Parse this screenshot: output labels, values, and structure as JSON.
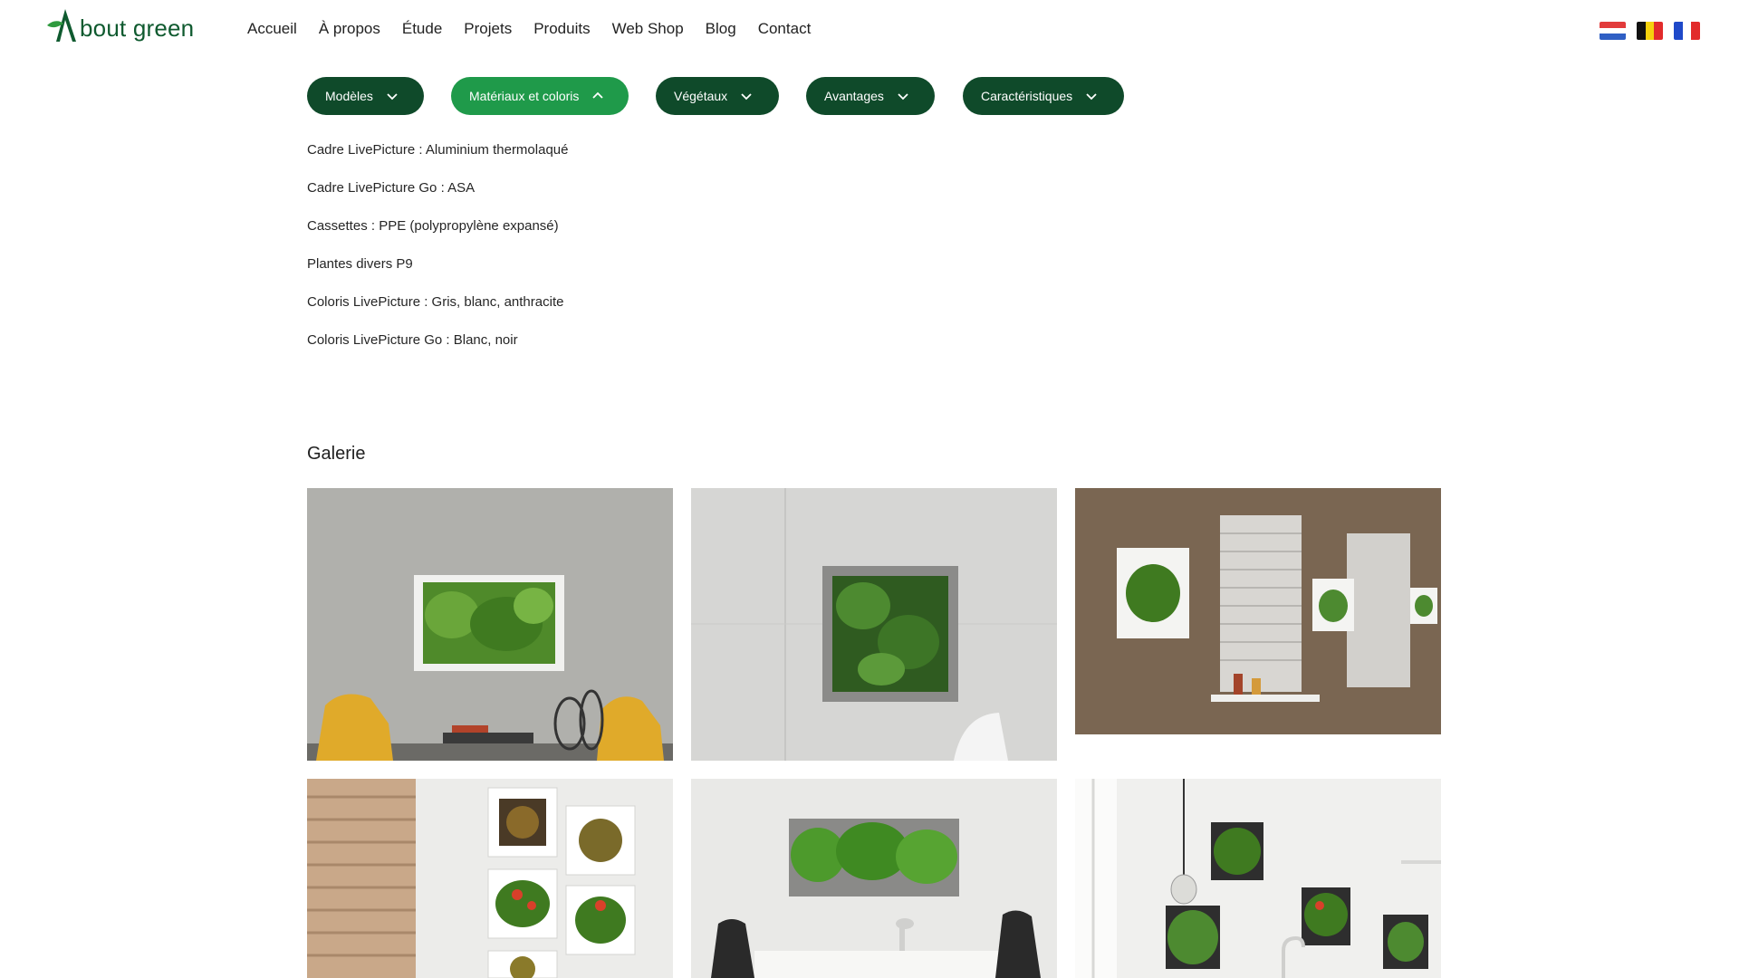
{
  "brand": {
    "name": "bout green"
  },
  "nav": {
    "items": [
      {
        "label": "Accueil"
      },
      {
        "label": "À propos"
      },
      {
        "label": "Étude"
      },
      {
        "label": "Projets"
      },
      {
        "label": "Produits"
      },
      {
        "label": "Web Shop"
      },
      {
        "label": "Blog"
      },
      {
        "label": "Contact"
      }
    ]
  },
  "languages": [
    {
      "name": "Nederlands",
      "icon": "flag-nl-icon"
    },
    {
      "name": "Belgique",
      "icon": "flag-be-icon"
    },
    {
      "name": "Français",
      "icon": "flag-fr-icon"
    }
  ],
  "filters": [
    {
      "label": "Modèles",
      "state": "collapsed"
    },
    {
      "label": "Matériaux et coloris",
      "state": "expanded"
    },
    {
      "label": "Végétaux",
      "state": "collapsed"
    },
    {
      "label": "Avantages",
      "state": "collapsed"
    },
    {
      "label": "Caractéristiques",
      "state": "collapsed"
    }
  ],
  "materials": [
    "Cadre LivePicture : Aluminium thermolaqué",
    "Cadre LivePicture Go : ASA",
    "Cassettes : PPE (polypropylène expansé)",
    "Plantes divers P9",
    "Coloris LivePicture : Gris, blanc, anthracite",
    "Coloris LivePicture Go : Blanc, noir"
  ],
  "gallery": {
    "title": "Galerie"
  },
  "colors": {
    "brand_dark": "#0f4a2a",
    "brand_active": "#1f9a4a",
    "logo": "#0f5a2f"
  }
}
